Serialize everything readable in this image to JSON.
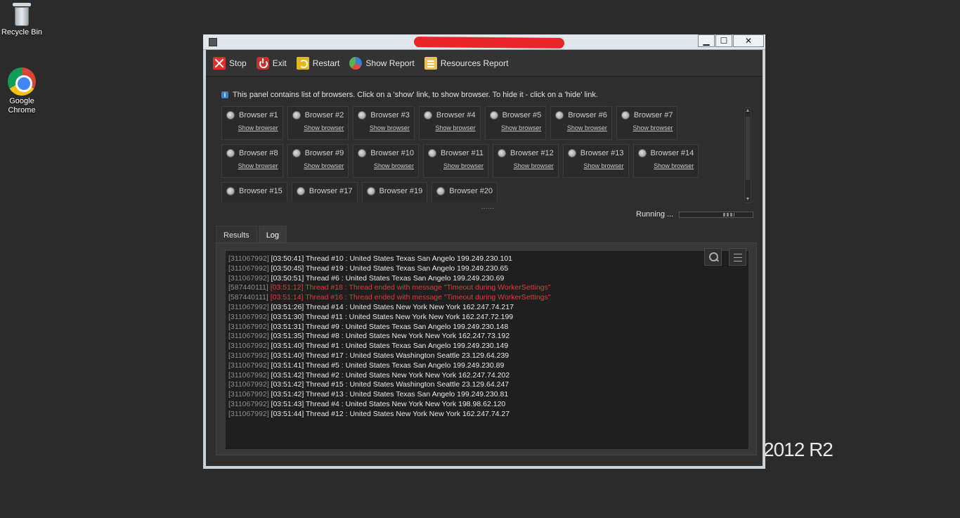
{
  "desktop": {
    "icons": [
      {
        "label": "Recycle Bin",
        "icon": "recycle-bin-icon"
      },
      {
        "label": "Google Chrome",
        "icon": "chrome-icon"
      }
    ],
    "os_watermark": "2012 R2"
  },
  "window": {
    "title_redacted": true,
    "controls": {
      "minimize": "▁",
      "maximize": "☐",
      "close": "✕"
    }
  },
  "toolbar": {
    "items": [
      {
        "label": "Stop",
        "icon": "stop-icon"
      },
      {
        "label": "Exit",
        "icon": "power-icon"
      },
      {
        "label": "Restart",
        "icon": "restart-icon"
      },
      {
        "label": "Show Report",
        "icon": "pie-chart-icon"
      },
      {
        "label": "Resources Report",
        "icon": "document-icon"
      }
    ]
  },
  "info_text": "This panel contains list of browsers. Click on a 'show' link, to show browser. To hide it - click on a 'hide' link.",
  "browsers": {
    "rows": [
      [
        {
          "name": "Browser #1",
          "link": "Show browser"
        },
        {
          "name": "Browser #2",
          "link": "Show browser"
        },
        {
          "name": "Browser #3",
          "link": "Show browser"
        },
        {
          "name": "Browser #4",
          "link": "Show browser"
        },
        {
          "name": "Browser #5",
          "link": "Show browser"
        },
        {
          "name": "Browser #6",
          "link": "Show browser"
        },
        {
          "name": "Browser #7",
          "link": "Show browser"
        }
      ],
      [
        {
          "name": "Browser #8",
          "link": "Show browser"
        },
        {
          "name": "Browser #9",
          "link": "Show browser"
        },
        {
          "name": "Browser #10",
          "link": "Show browser"
        },
        {
          "name": "Browser #11",
          "link": "Show browser"
        },
        {
          "name": "Browser #12",
          "link": "Show browser"
        },
        {
          "name": "Browser #13",
          "link": "Show browser"
        },
        {
          "name": "Browser #14",
          "link": "Show browser"
        }
      ],
      [
        {
          "name": "Browser #15",
          "link": ""
        },
        {
          "name": "Browser #17",
          "link": ""
        },
        {
          "name": "Browser #19",
          "link": ""
        },
        {
          "name": "Browser #20",
          "link": ""
        }
      ]
    ],
    "more_indicator": "......"
  },
  "status": {
    "label": "Running ..."
  },
  "tabs": [
    {
      "label": "Results",
      "active": false
    },
    {
      "label": "Log",
      "active": true
    }
  ],
  "log": [
    {
      "id": "[311067992]",
      "text": "[03:50:41] Thread #10 : United States Texas San Angelo 199.249.230.101",
      "error": false
    },
    {
      "id": "[311067992]",
      "text": "[03:50:45] Thread #19 : United States Texas San Angelo 199.249.230.65",
      "error": false
    },
    {
      "id": "[311067992]",
      "text": "[03:50:51] Thread #6 : United States Texas San Angelo 199.249.230.69",
      "error": false
    },
    {
      "id": "[587440111]",
      "text": "[03:51:12] Thread #18 : Thread ended with message \"Timeout during WorkerSettings\"",
      "error": true
    },
    {
      "id": "[587440111]",
      "text": "[03:51:14] Thread #16 : Thread ended with message \"Timeout during WorkerSettings\"",
      "error": true
    },
    {
      "id": "[311067992]",
      "text": "[03:51:26] Thread #14 : United States New York New York 162.247.74.217",
      "error": false
    },
    {
      "id": "[311067992]",
      "text": "[03:51:30] Thread #11 : United States New York New York 162.247.72.199",
      "error": false
    },
    {
      "id": "[311067992]",
      "text": "[03:51:31] Thread #9 : United States Texas San Angelo 199.249.230.148",
      "error": false
    },
    {
      "id": "[311067992]",
      "text": "[03:51:35] Thread #8 : United States New York New York 162.247.73.192",
      "error": false
    },
    {
      "id": "[311067992]",
      "text": "[03:51:40] Thread #1 : United States Texas San Angelo 199.249.230.149",
      "error": false
    },
    {
      "id": "[311067992]",
      "text": "[03:51:40] Thread #17 : United States Washington Seattle 23.129.64.239",
      "error": false
    },
    {
      "id": "[311067992]",
      "text": "[03:51:41] Thread #5 : United States Texas San Angelo 199.249.230.89",
      "error": false
    },
    {
      "id": "[311067992]",
      "text": "[03:51:42] Thread #2 : United States New York New York 162.247.74.202",
      "error": false
    },
    {
      "id": "[311067992]",
      "text": "[03:51:42] Thread #15 : United States Washington Seattle 23.129.64.247",
      "error": false
    },
    {
      "id": "[311067992]",
      "text": "[03:51:42] Thread #13 : United States Texas San Angelo 199.249.230.81",
      "error": false
    },
    {
      "id": "[311067992]",
      "text": "[03:51:43] Thread #4 : United States New York New York 198.98.62.120",
      "error": false
    },
    {
      "id": "[311067992]",
      "text": "[03:51:44] Thread #12 : United States New York New York 162.247.74.27",
      "error": false
    }
  ],
  "colors": {
    "error_text": "#e23a3a",
    "background": "#2e2e2e",
    "log_background": "#1f1f1f"
  }
}
